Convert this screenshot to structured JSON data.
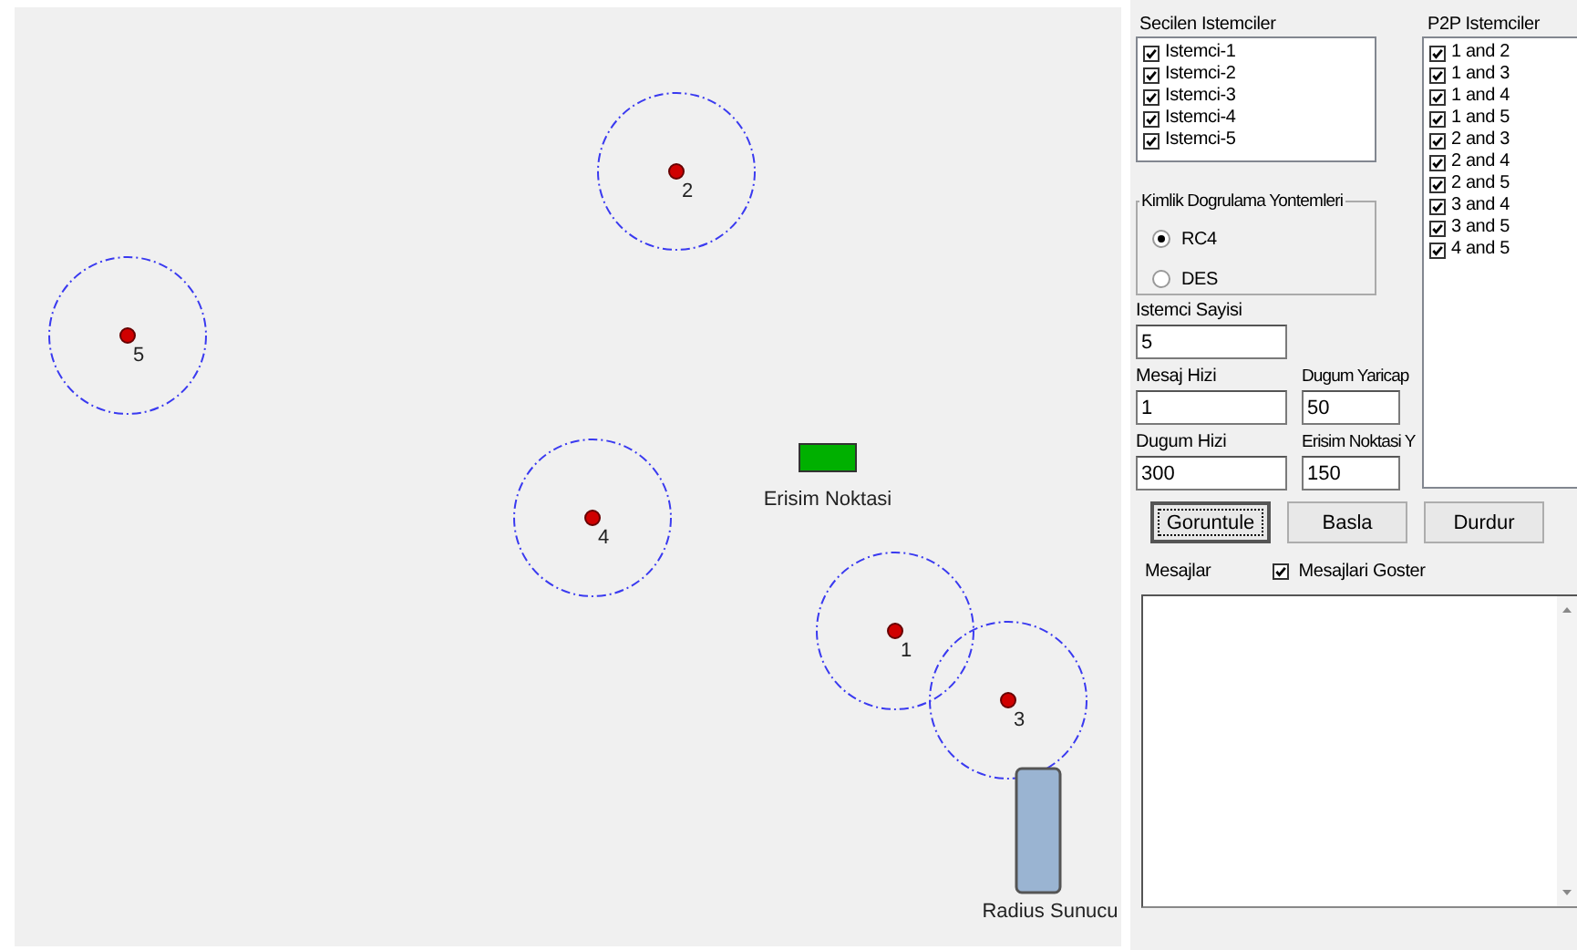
{
  "canvas": {
    "nodes": [
      {
        "label": "1"
      },
      {
        "label": "2"
      },
      {
        "label": "3"
      },
      {
        "label": "4"
      },
      {
        "label": "5"
      }
    ],
    "access_point": {
      "label": "Erisim Noktasi"
    },
    "server": {
      "label": "Radius Sunucu"
    }
  },
  "selected_clients": {
    "title": "Secilen Istemciler",
    "items": [
      {
        "label": "Istemci-1",
        "checked": true
      },
      {
        "label": "Istemci-2",
        "checked": true
      },
      {
        "label": "Istemci-3",
        "checked": true
      },
      {
        "label": "Istemci-4",
        "checked": true
      },
      {
        "label": "Istemci-5",
        "checked": true
      }
    ]
  },
  "p2p_clients": {
    "title": "P2P Istemciler",
    "items": [
      {
        "label": "1 and 2",
        "checked": true
      },
      {
        "label": "1 and 3",
        "checked": true
      },
      {
        "label": "1 and 4",
        "checked": true
      },
      {
        "label": "1 and 5",
        "checked": true
      },
      {
        "label": "2 and 3",
        "checked": true
      },
      {
        "label": "2 and 4",
        "checked": true
      },
      {
        "label": "2 and 5",
        "checked": true
      },
      {
        "label": "3 and 4",
        "checked": true
      },
      {
        "label": "3 and 5",
        "checked": true
      },
      {
        "label": "4 and 5",
        "checked": true
      }
    ]
  },
  "auth_method": {
    "title": "Kimlik Dogrulama Yontemleri",
    "options": [
      {
        "label": "RC4",
        "selected": true
      },
      {
        "label": "DES",
        "selected": false
      }
    ]
  },
  "fields": [
    {
      "label": "Istemci Sayisi",
      "value": "5"
    },
    {
      "label": "Mesaj Hizi",
      "value": "1"
    },
    {
      "label": "Dugum Yaricap",
      "value": "50"
    },
    {
      "label": "Dugum Hizi",
      "value": "300"
    },
    {
      "label": "Erisim Noktasi Y",
      "value": "150"
    }
  ],
  "buttons": [
    {
      "label": "Goruntule",
      "focused": true
    },
    {
      "label": "Basla",
      "focused": false
    },
    {
      "label": "Durdur",
      "focused": false
    }
  ],
  "messages": {
    "label": "Mesajlar",
    "show_messages": {
      "label": "Mesajlari Goster",
      "checked": true
    }
  }
}
